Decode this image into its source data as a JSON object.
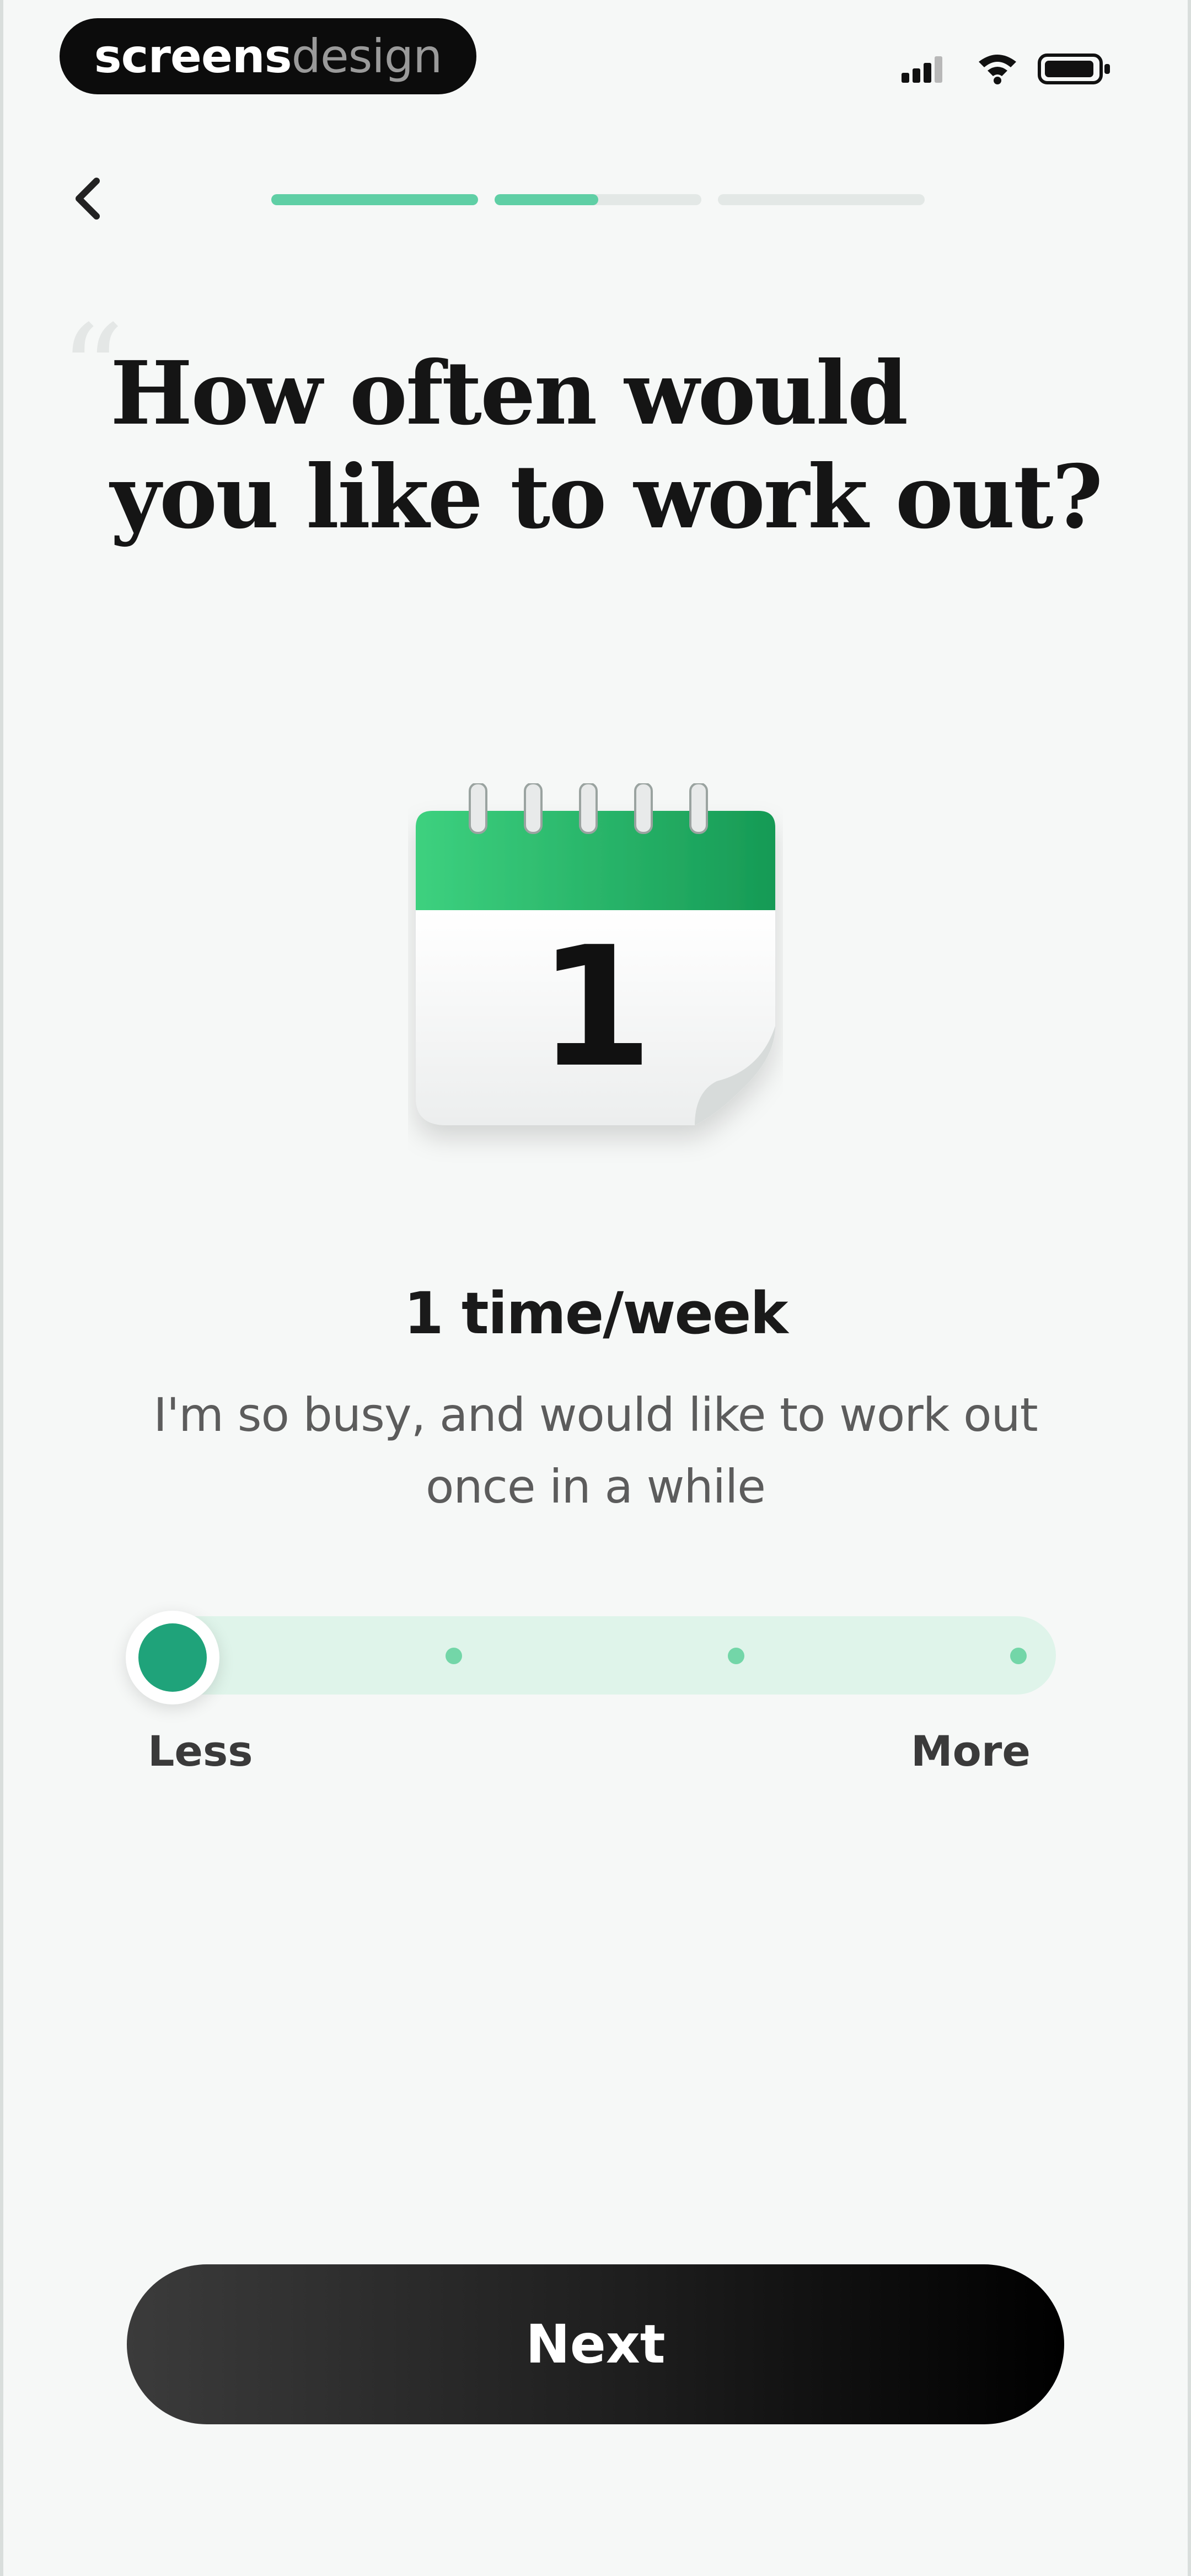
{
  "status_bar": {
    "brand_primary": "screens",
    "brand_secondary": "design",
    "icons": [
      "signal-icon",
      "wifi-icon",
      "battery-icon"
    ]
  },
  "nav": {
    "back_icon": "chevron-left-icon",
    "progress": {
      "total_steps": 3,
      "current_step_fraction": 0.5,
      "completed_steps": 1
    }
  },
  "question": {
    "title_line1": "How often would",
    "title_line2": "you like to work out?"
  },
  "calendar": {
    "icon": "calendar-icon",
    "number": "1"
  },
  "frequency": {
    "label": "1 time/week",
    "description_line1": "I'm so busy, and would like to work out",
    "description_line2": "once in a while"
  },
  "slider": {
    "min_label": "Less",
    "max_label": "More",
    "stops": 4,
    "selected_index": 0
  },
  "footer": {
    "next_label": "Next"
  },
  "colors": {
    "accent": "#1fa37a",
    "accent_light": "#dff4ea",
    "progress_active": "#5fcfa5",
    "progress_inactive": "#e3e8e6",
    "calendar_green": "#2bb56d",
    "background": "#f6f8f7"
  }
}
